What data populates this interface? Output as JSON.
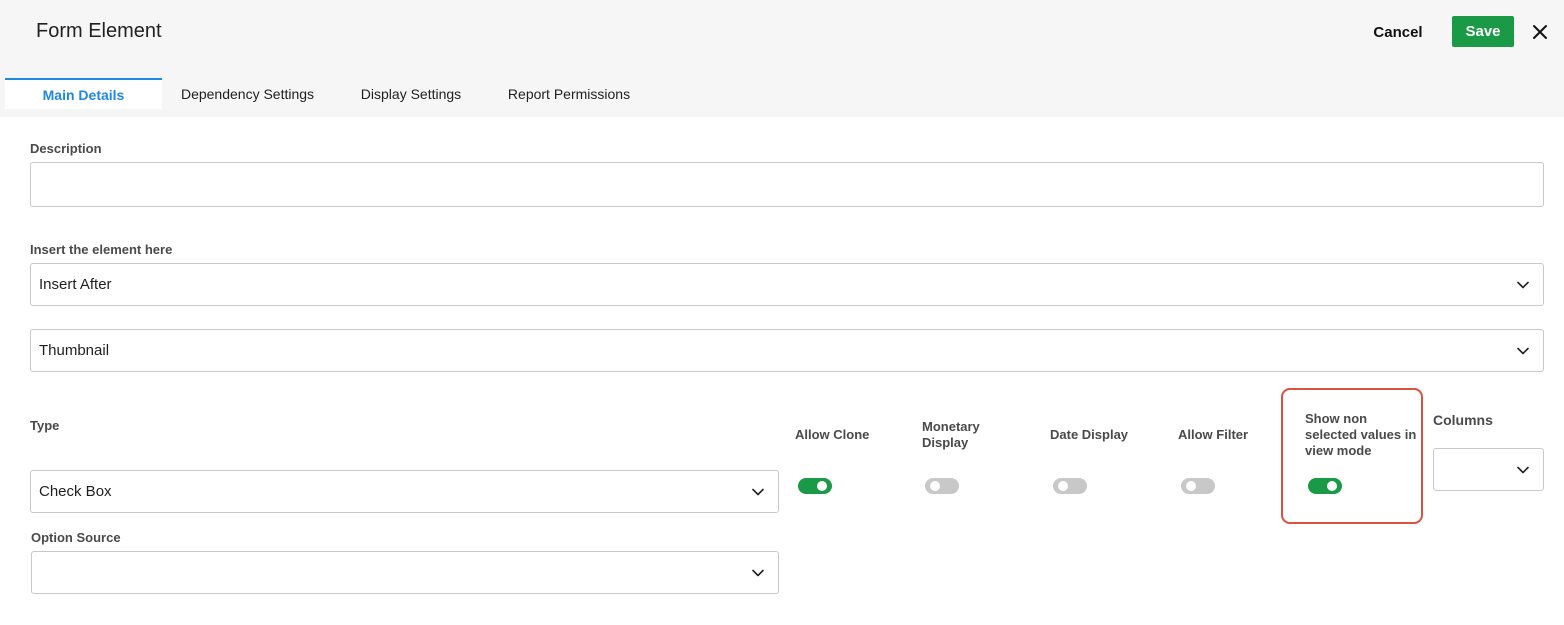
{
  "header": {
    "title": "Form Element",
    "cancel_label": "Cancel",
    "save_label": "Save",
    "close_icon": "close-icon"
  },
  "tabs": [
    {
      "label": "Main Details",
      "active": true
    },
    {
      "label": "Dependency Settings",
      "active": false
    },
    {
      "label": "Display Settings",
      "active": false
    },
    {
      "label": "Report Permissions",
      "active": false
    }
  ],
  "form": {
    "description": {
      "label": "Description",
      "value": ""
    },
    "insert_position": {
      "label": "Insert the element here",
      "value": "Insert After"
    },
    "insert_target": {
      "value": "Thumbnail"
    },
    "type": {
      "label": "Type",
      "value": "Check Box"
    },
    "option_source": {
      "label": "Option Source",
      "value": ""
    },
    "toggles": [
      {
        "label": "Allow Clone",
        "on": true
      },
      {
        "label": "Monetary Display",
        "on": false
      },
      {
        "label": "Date Display",
        "on": false
      },
      {
        "label": "Allow Filter",
        "on": false
      },
      {
        "label": "Show non selected values in view mode",
        "on": true,
        "highlighted": true
      }
    ],
    "columns": {
      "label": "Columns",
      "value": ""
    }
  },
  "colors": {
    "accent_blue": "#1e88e5",
    "save_green": "#1a9a47",
    "highlight_red": "#d9533f",
    "toggle_off": "#c8c8c8"
  }
}
